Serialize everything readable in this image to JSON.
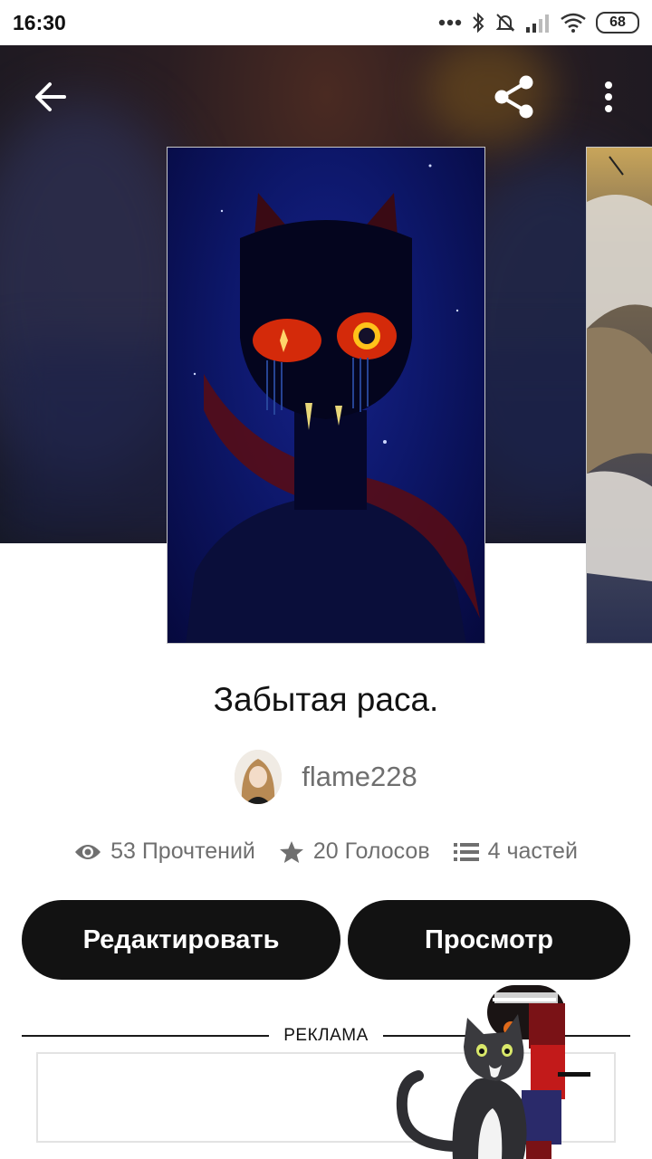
{
  "status_bar": {
    "time": "16:30",
    "battery": "68",
    "icons": [
      "more-dots-icon",
      "bluetooth-icon",
      "mute-icon",
      "signal-icon",
      "wifi-icon",
      "battery-icon"
    ]
  },
  "toolbar": {
    "back_icon": "arrow-left-icon",
    "share_icon": "share-icon",
    "more_icon": "more-vertical-icon"
  },
  "story": {
    "title": "Забытая раса.",
    "author": "flame228",
    "stats": {
      "reads": "53 Прочтений",
      "votes": "20 Голосов",
      "parts": "4 частей"
    }
  },
  "actions": {
    "edit_label": "Редактировать",
    "view_label": "Просмотр"
  },
  "ad": {
    "label": "РЕКЛАМА"
  },
  "colors": {
    "button_bg": "#121212",
    "text_primary": "#121212",
    "text_secondary": "#6f6f6f",
    "cover_bg": "#0d176a"
  }
}
